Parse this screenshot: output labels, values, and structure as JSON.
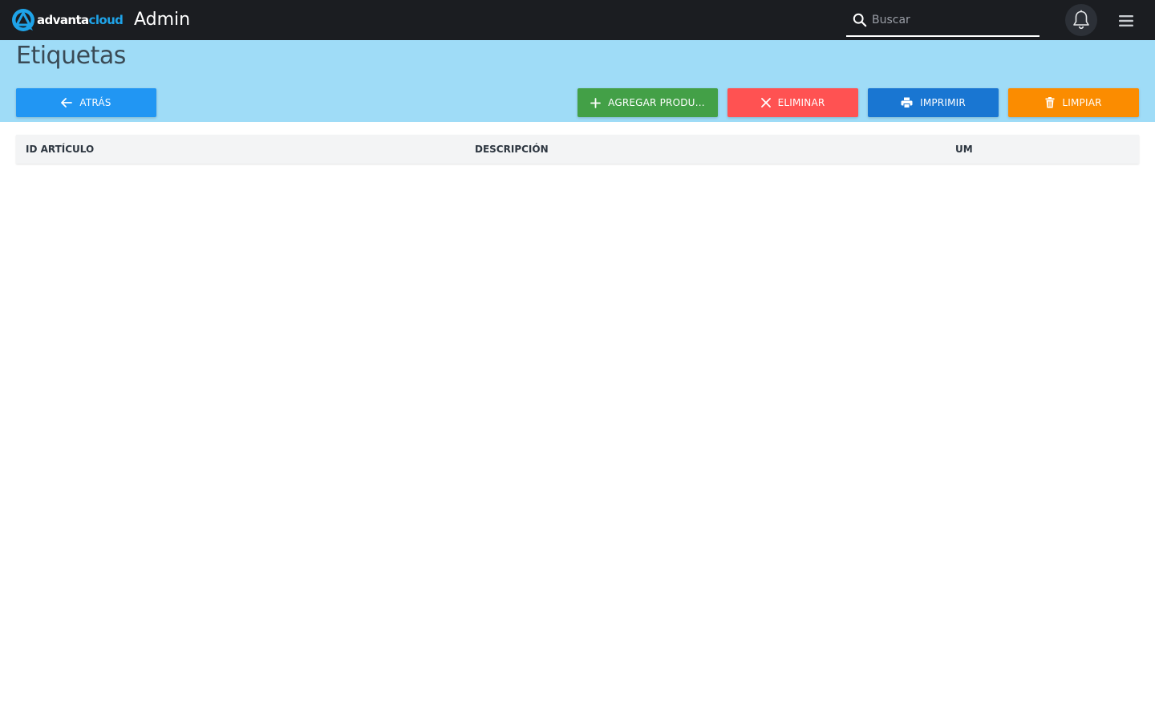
{
  "brand": {
    "logo_part1": "advanta",
    "logo_part2": "cloud",
    "logo_icon": "advanta-logo-mark",
    "app_title": "Admin",
    "accent_color": "#1fa3e8"
  },
  "search": {
    "placeholder": "Buscar",
    "value": "",
    "icon": "search-icon"
  },
  "header_icons": {
    "notifications": "bell-icon",
    "menu": "hamburger-menu-icon"
  },
  "page": {
    "title": "Etiquetas",
    "band_color": "#9fdcf7"
  },
  "toolbar": {
    "back": {
      "label": "ATRÁS",
      "icon": "arrow-left-icon",
      "color": "#2196f3"
    },
    "add": {
      "label": "AGREGAR PRODU…",
      "icon": "plus-icon",
      "color": "#43a047"
    },
    "delete": {
      "label": "ELIMINAR",
      "icon": "close-icon",
      "color": "#ff5252"
    },
    "print": {
      "label": "IMPRIMIR",
      "icon": "printer-icon",
      "color": "#1976d2"
    },
    "clear": {
      "label": "LIMPIAR",
      "icon": "trash-icon",
      "color": "#fb8c00"
    }
  },
  "table": {
    "columns": [
      "ID ARTÍCULO",
      "DESCRIPCIÓN",
      "UM"
    ],
    "rows": []
  }
}
